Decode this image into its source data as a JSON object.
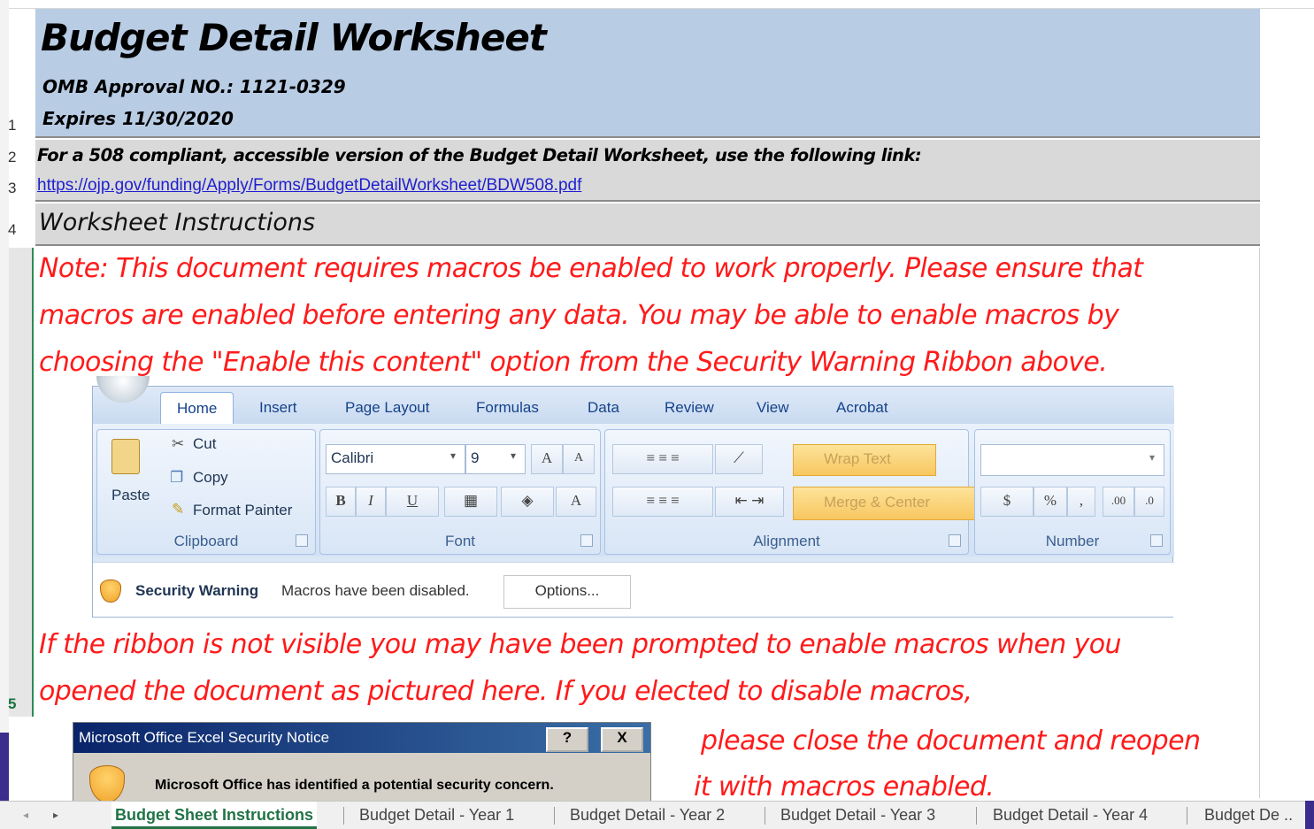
{
  "sheet": {
    "row_numbers": [
      "1",
      "2",
      "3",
      "4",
      "5"
    ],
    "title": "Budget Detail Worksheet",
    "omb": "OMB Approval NO.: 1121-0329",
    "expires": "Expires 11/30/2020",
    "compliant_text": "For a 508 compliant, accessible version of the Budget Detail Worksheet, use the following link:",
    "link": "https://ojp.gov/funding/Apply/Forms/BudgetDetailWorksheet/BDW508.pdf",
    "instructions_header": "Worksheet Instructions",
    "note_lines": [
      "Note: This document requires macros be enabled to work properly. Please ensure that",
      "macros are enabled before entering any data. You may be able to enable macros by",
      "choosing the \"Enable this content\" option from the Security Warning Ribbon above."
    ],
    "ribbon_lines": [
      "If the ribbon is not visible you may have been prompted to enable macros when you",
      "opened the document as pictured here. If you elected to disable macros,"
    ],
    "close_lines": [
      "please close the document and reopen",
      "it with macros enabled."
    ]
  },
  "ribbon": {
    "tabs": [
      "Home",
      "Insert",
      "Page Layout",
      "Formulas",
      "Data",
      "Review",
      "View",
      "Acrobat"
    ],
    "clipboard": {
      "paste": "Paste",
      "cut": "Cut",
      "copy": "Copy",
      "format_painter": "Format Painter",
      "label": "Clipboard"
    },
    "font": {
      "name": "Calibri",
      "size": "9",
      "bold": "B",
      "italic": "I",
      "underline": "U",
      "label": "Font",
      "grow": "A",
      "shrink": "A",
      "color": "A"
    },
    "alignment": {
      "wrap": "Wrap Text",
      "merge": "Merge & Center",
      "label": "Alignment"
    },
    "number": {
      "currency": "$",
      "percent": "%",
      "comma": ",",
      "inc": ".00",
      "dec": ".0",
      "label": "Number"
    },
    "security": {
      "title": "Security Warning",
      "message": "Macros have been disabled.",
      "options": "Options..."
    }
  },
  "dialog": {
    "title": "Microsoft Office Excel Security Notice",
    "help": "?",
    "close": "X",
    "message": "Microsoft Office has identified a potential security concern."
  },
  "sheet_tabs": [
    "Budget Sheet Instructions",
    "Budget Detail - Year 1",
    "Budget Detail - Year 2",
    "Budget Detail - Year 3",
    "Budget Detail - Year 4",
    "Budget De .."
  ],
  "colors": {
    "header_band": "#b8cce4",
    "note_red": "#ff1a1a",
    "link_blue": "#1f1fd0",
    "active_tab": "#217346"
  }
}
